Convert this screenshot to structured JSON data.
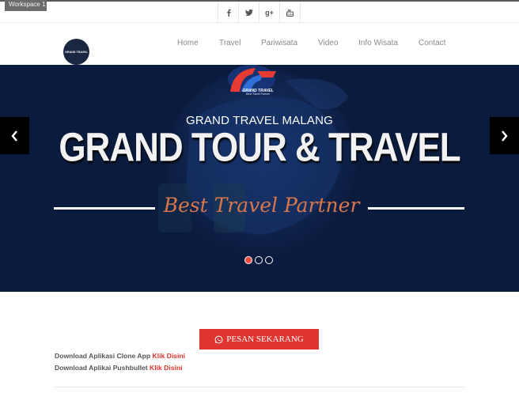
{
  "workspace": {
    "label": "Workspace 1"
  },
  "social": {
    "icons": [
      "facebook-icon",
      "twitter-icon",
      "google-plus-icon",
      "youtube-icon"
    ],
    "google_plus_label": "g+"
  },
  "logo": {
    "text": "GRAND TRAVEL"
  },
  "nav": {
    "items": [
      {
        "label": "Home"
      },
      {
        "label": "Travel"
      },
      {
        "label": "Pariwisata"
      },
      {
        "label": "Video"
      },
      {
        "label": "Info Wisata"
      },
      {
        "label": "Contact"
      }
    ]
  },
  "hero": {
    "brand_name": "GRAND TRAVEL",
    "brand_tagline": "Best Travel Partner",
    "subtitle": "GRAND TRAVEL MALANG",
    "title": "GRAND TOUR & TRAVEL",
    "tagline": "Best Travel Partner",
    "slide_count": 3,
    "active_slide": 1,
    "prev_icon": "chevron-left-icon",
    "next_icon": "chevron-right-icon"
  },
  "cta": {
    "label": "PESAN SEKARANG",
    "icon": "whatsapp-icon"
  },
  "downloads": [
    {
      "text": "Download Aplikasi Clone App",
      "link": "Klik Disini"
    },
    {
      "text": "Download Aplikai Pushbullet",
      "link": "Klik Disini"
    }
  ],
  "colors": {
    "accent": "#e0342f",
    "hero_bg": "#0b1b3d",
    "tagline": "#d9774a",
    "nav_text": "#8a8a8a"
  }
}
